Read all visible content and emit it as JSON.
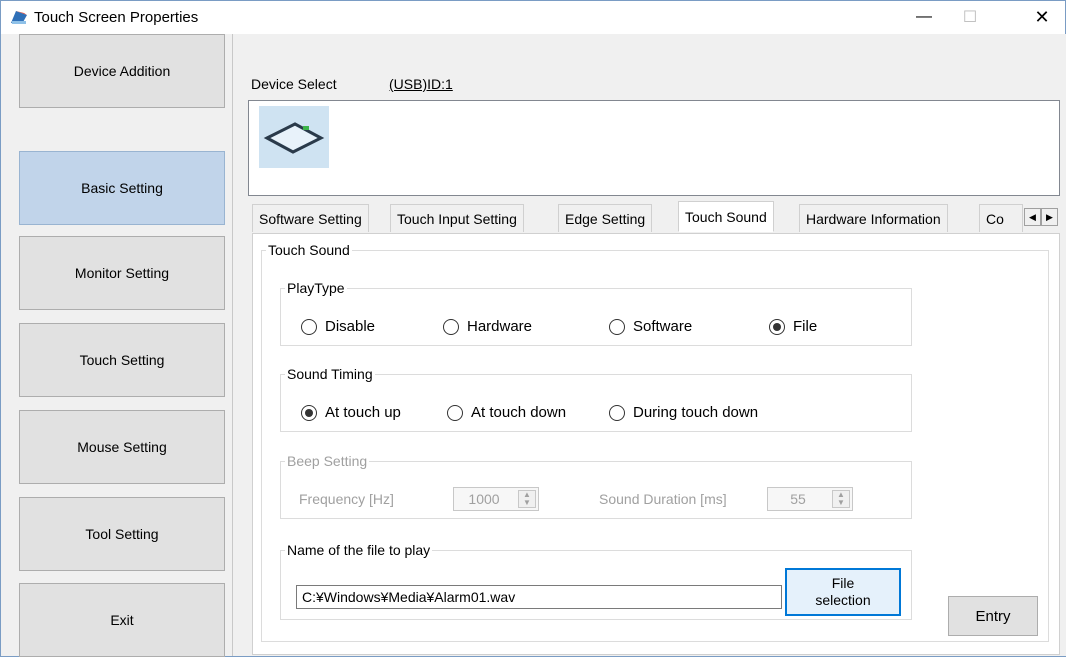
{
  "window": {
    "title": "Touch Screen Properties",
    "controls": {
      "minimize": "—",
      "maximize": "☐",
      "close": "✕"
    }
  },
  "sidebar": {
    "items": [
      {
        "label": "Device Addition",
        "active": false
      },
      {
        "label": "Basic Setting",
        "active": true
      },
      {
        "label": "Monitor Setting",
        "active": false
      },
      {
        "label": "Touch Setting",
        "active": false
      },
      {
        "label": "Mouse Setting",
        "active": false
      },
      {
        "label": "Tool Setting",
        "active": false
      },
      {
        "label": "Exit",
        "active": false
      }
    ]
  },
  "device": {
    "select_label": "Device Select",
    "selected_id": "(USB)ID:1"
  },
  "tabs": [
    {
      "label": "Software Setting"
    },
    {
      "label": "Touch Input Setting"
    },
    {
      "label": "Edge Setting"
    },
    {
      "label": "Touch Sound",
      "active": true
    },
    {
      "label": "Hardware Information"
    },
    {
      "label": "Co"
    }
  ],
  "tab_scroll": {
    "left": "◀",
    "right": "▶"
  },
  "touch_sound": {
    "group_label": "Touch Sound",
    "play_type": {
      "label": "PlayType",
      "options": [
        "Disable",
        "Hardware",
        "Software",
        "File"
      ],
      "selected": "File"
    },
    "sound_timing": {
      "label": "Sound Timing",
      "options": [
        "At touch up",
        "At touch down",
        "During touch down"
      ],
      "selected": "At touch up"
    },
    "beep_setting": {
      "label": "Beep Setting",
      "frequency_label": "Frequency [Hz]",
      "frequency_value": "1000",
      "duration_label": "Sound Duration [ms]",
      "duration_value": "55"
    },
    "file": {
      "label": "Name of the file to play",
      "path": "C:¥Windows¥Media¥Alarm01.wav",
      "button_line1": "File",
      "button_line2": "selection"
    }
  },
  "entry_button": "Entry",
  "colors": {
    "active_nav": "#c1d4ea",
    "focus_border": "#0078d7"
  }
}
